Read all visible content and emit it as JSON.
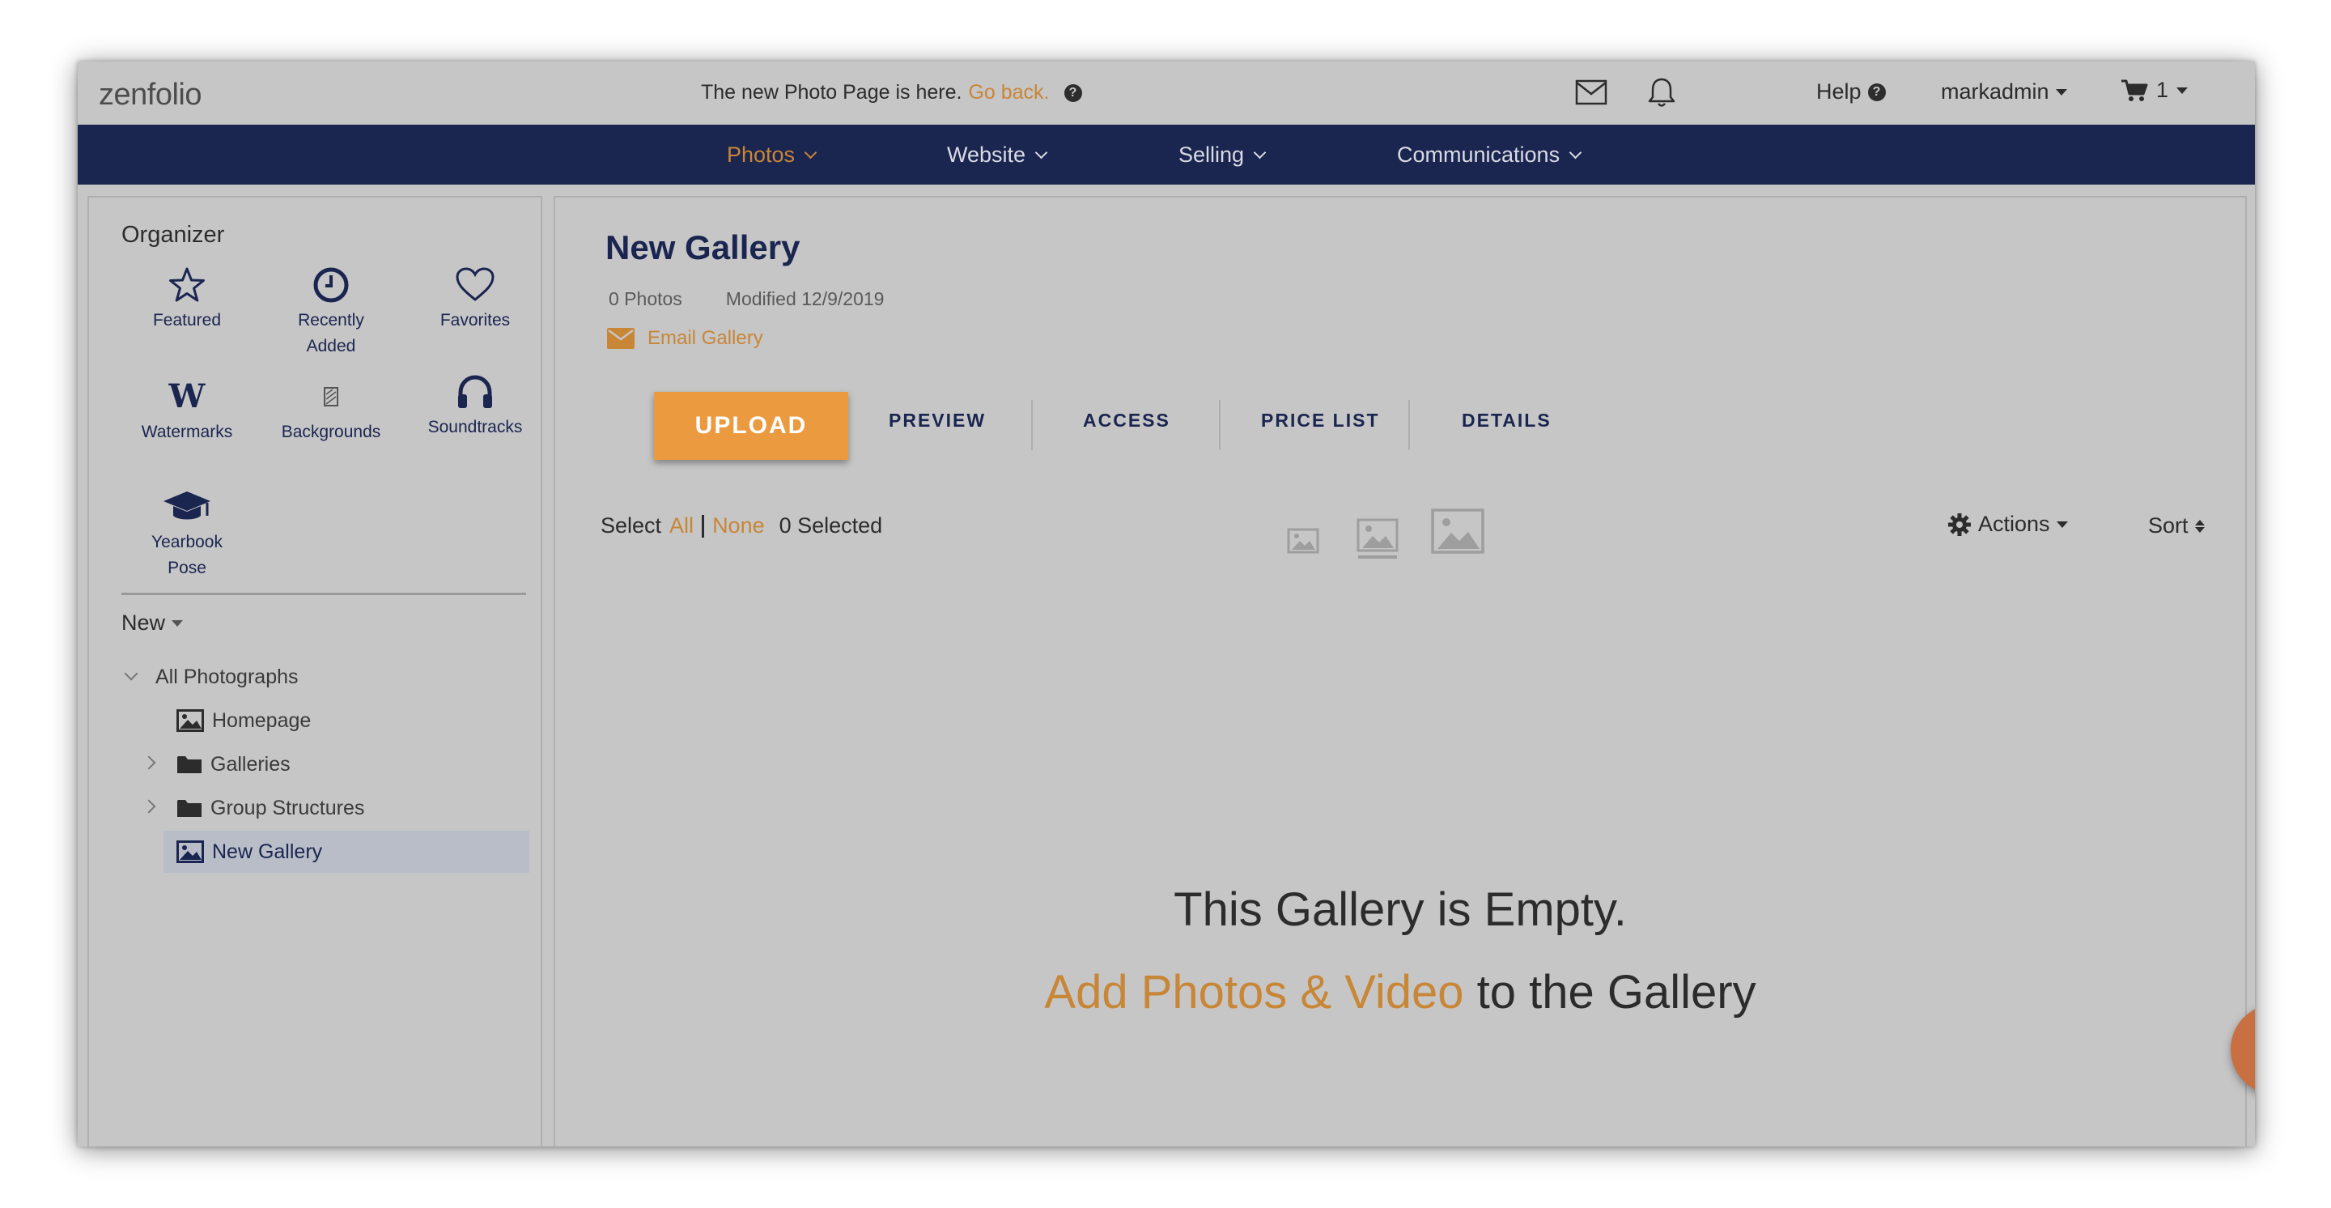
{
  "topbar": {
    "logo": "zenfolio",
    "notice_text": "The new Photo Page is here.",
    "notice_link": "Go back.",
    "help_label": "Help",
    "username": "markadmin",
    "cart_count": "1"
  },
  "nav": {
    "items": [
      {
        "label": "Photos",
        "active": true
      },
      {
        "label": "Website",
        "active": false
      },
      {
        "label": "Selling",
        "active": false
      },
      {
        "label": "Communications",
        "active": false
      }
    ]
  },
  "sidebar": {
    "title": "Organizer",
    "tiles": [
      {
        "label": "Featured",
        "icon": "star-icon"
      },
      {
        "label": "Recently Added",
        "icon": "clock-icon"
      },
      {
        "label": "Favorites",
        "icon": "heart-icon"
      },
      {
        "label": "Watermarks",
        "icon": "watermark-icon"
      },
      {
        "label": "Backgrounds",
        "icon": "background-icon"
      },
      {
        "label": "Soundtracks",
        "icon": "headphones-icon"
      },
      {
        "label": "Yearbook Pose",
        "icon": "graduation-cap-icon"
      }
    ],
    "new_label": "New",
    "tree": [
      {
        "label": "All Photographs",
        "type": "root"
      },
      {
        "label": "Homepage",
        "type": "gallery"
      },
      {
        "label": "Galleries",
        "type": "folder"
      },
      {
        "label": "Group Structures",
        "type": "folder"
      },
      {
        "label": "New Gallery",
        "type": "gallery",
        "selected": true
      }
    ]
  },
  "main": {
    "title": "New Gallery",
    "photo_count": "0 Photos",
    "modified": "Modified 12/9/2019",
    "email_label": "Email Gallery",
    "upload_label": "UPLOAD",
    "tabs": [
      "PREVIEW",
      "ACCESS",
      "PRICE LIST",
      "DETAILS"
    ],
    "select_label": "Select",
    "select_all": "All",
    "select_none": "None",
    "selected_count": "0 Selected",
    "actions_label": "Actions",
    "sort_label": "Sort",
    "empty_title": "This Gallery is Empty.",
    "empty_link": "Add Photos & Video",
    "empty_suffix": "to the Gallery"
  },
  "colors": {
    "accent": "#c88637",
    "nav_bg": "#1a2550",
    "upload_bg": "#eb9a40",
    "chat_bg": "#c87041"
  }
}
